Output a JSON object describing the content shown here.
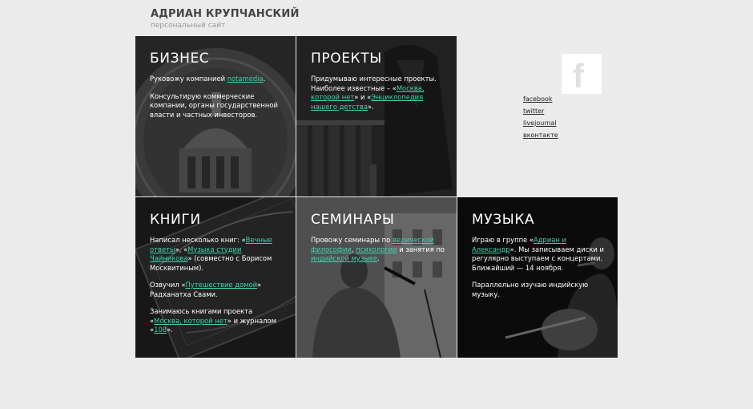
{
  "header": {
    "title": "АДРИАН КРУПЧАНСКИЙ",
    "subtitle": "персональный сайт"
  },
  "tiles": {
    "business": {
      "title": "БИЗНЕС",
      "p1_text": "Руковожу компанией ",
      "p1_link": "notamedia",
      "p1_end": ".",
      "p2": "Консультирую коммерческие компании, органы государственной власти и частных инвесторов."
    },
    "projects": {
      "title": "ПРОЕКТЫ",
      "p1_a": "Придумываю интересные проекты. Наиболее известные – «",
      "link1": "Москва, которой нет",
      "p1_b": "» и «",
      "link2": "Энциклопедия нашего детства",
      "p1_c": "»."
    },
    "books": {
      "title": "КНИГИ",
      "p1_a": "Написал несколько книг: «",
      "link1": "Вечные ответы",
      "p1_b": "», «",
      "link2": "Музыка студии Чайникова",
      "p1_c": "» (совместно с Борисом Москвитиным).",
      "p2_a": "Озвучил «",
      "link3": "Путешествие домой",
      "p2_b": "» Радханатха Свами.",
      "p3_a": "Занимаюсь книгами проекта «",
      "link4": "Москва, которой нет",
      "p3_b": "» и журналом «",
      "link5": "108",
      "p3_c": "»."
    },
    "seminars": {
      "title": "СЕМИНАРЫ",
      "p1_a": "Провожу семинары по ",
      "link1": "ведической философии",
      "p1_b": ", ",
      "link2": "психологии",
      "p1_c": " и занятия по ",
      "link3": "индийской музыке",
      "p1_d": "."
    },
    "music": {
      "title": "МУЗЫКА",
      "p1_a": "Играю в группе «",
      "link1": "Адриан и Александр",
      "p1_b": "». Мы записываем диски и регулярно выступаем с концертами. Ближайший — 14 ноября.",
      "p2": "Параллельно изучаю индийскую музыку."
    }
  },
  "social": {
    "icon": "facebook-icon",
    "links": [
      "facebook",
      "twitter",
      "livejournal",
      "вконтакте"
    ]
  },
  "colors": {
    "link": "#3fd4b1",
    "background": "#ebebeb"
  }
}
